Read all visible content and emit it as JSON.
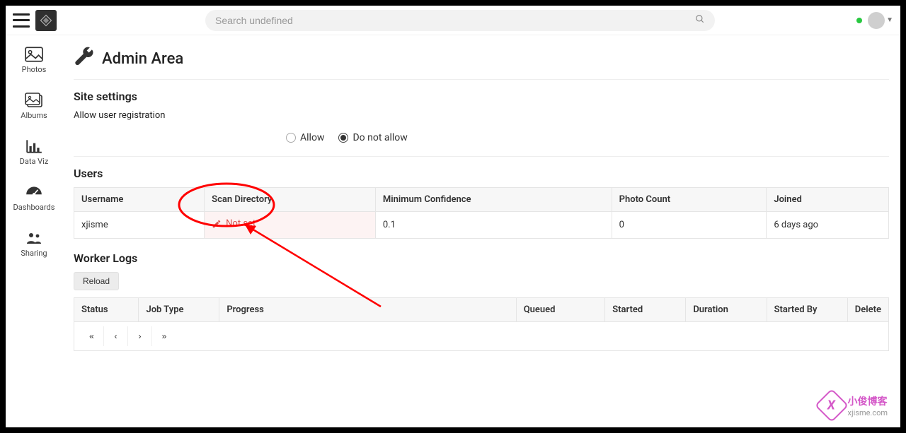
{
  "topbar": {
    "search_placeholder": "Search undefined"
  },
  "sidebar": {
    "items": [
      {
        "label": "Photos"
      },
      {
        "label": "Albums"
      },
      {
        "label": "Data Viz"
      },
      {
        "label": "Dashboards"
      },
      {
        "label": "Sharing"
      }
    ]
  },
  "page": {
    "title": "Admin Area"
  },
  "site_settings": {
    "heading": "Site settings",
    "setting_label": "Allow user registration",
    "option_allow": "Allow",
    "option_disallow": "Do not allow"
  },
  "users": {
    "heading": "Users",
    "columns": {
      "username": "Username",
      "scan_dir": "Scan Directory",
      "min_conf": "Minimum Confidence",
      "photo_count": "Photo Count",
      "joined": "Joined"
    },
    "rows": [
      {
        "username": "xjisme",
        "scan_dir": "Not set",
        "min_conf": "0.1",
        "photo_count": "0",
        "joined": "6 days ago"
      }
    ]
  },
  "worker_logs": {
    "heading": "Worker Logs",
    "reload_label": "Reload",
    "columns": {
      "status": "Status",
      "job_type": "Job Type",
      "progress": "Progress",
      "queued": "Queued",
      "started": "Started",
      "duration": "Duration",
      "started_by": "Started By",
      "delete": "Delete"
    }
  },
  "watermark": {
    "cn": "小俊博客",
    "dom": "xjisme.com"
  }
}
